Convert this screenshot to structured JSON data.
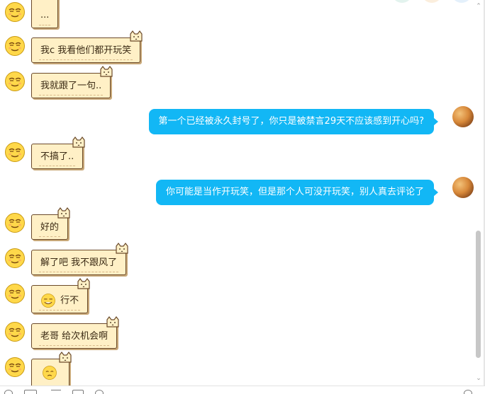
{
  "messages": [
    {
      "side": "left",
      "text": "..."
    },
    {
      "side": "left",
      "text": "我c 我看他们都开玩笑"
    },
    {
      "side": "left",
      "text": "我就跟了一句.."
    },
    {
      "side": "right",
      "text": "第一个已经被永久封号了，你只是被禁言29天不应该感到开心吗?"
    },
    {
      "side": "left",
      "text": "不搞了.."
    },
    {
      "side": "right",
      "text": "你可能是当作开玩笑，但是那个人可没开玩笑，别人真去评论了"
    },
    {
      "side": "left",
      "text": "好的"
    },
    {
      "side": "left",
      "text": "解了吧 我不跟风了"
    },
    {
      "side": "left",
      "text": "行不",
      "emoji": "smile-emoji"
    },
    {
      "side": "left",
      "text": "老哥 给次机会啊"
    },
    {
      "side": "left",
      "text": "",
      "emoji": "crying-emoji"
    }
  ],
  "colors": {
    "outgoing_bubble": "#12b7f5",
    "incoming_bubble": "#fff0c6",
    "incoming_border": "#6b4a2a"
  },
  "icons": {
    "sender_avatar": "squinting-face-emoji",
    "self_avatar": "photo-avatar",
    "bubble_decoration": "cat-icon"
  }
}
